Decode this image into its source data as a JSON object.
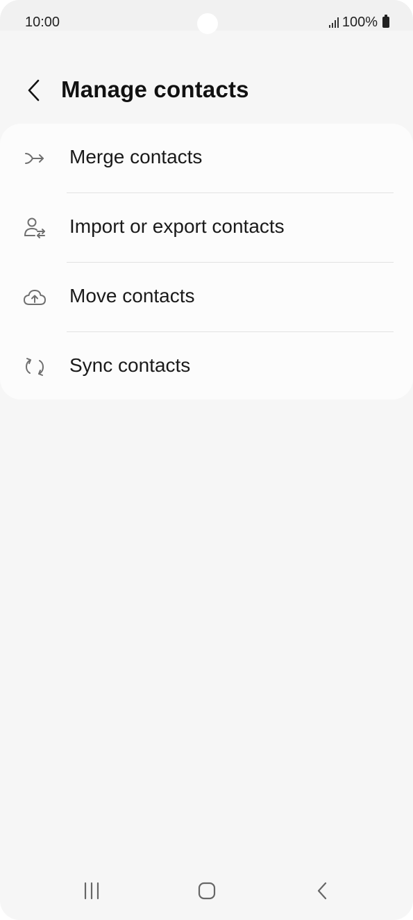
{
  "status_bar": {
    "time": "10:00",
    "battery": "100%"
  },
  "header": {
    "title": "Manage contacts",
    "back_icon": "chevron-left-icon"
  },
  "menu": {
    "items": [
      {
        "label": "Merge contacts",
        "icon": "merge-arrow-icon"
      },
      {
        "label": "Import or export contacts",
        "icon": "person-transfer-icon"
      },
      {
        "label": "Move contacts",
        "icon": "cloud-upload-icon"
      },
      {
        "label": "Sync contacts",
        "icon": "sync-icon"
      }
    ]
  },
  "nav_bar": {
    "recents_icon": "recents-icon",
    "home_icon": "home-icon",
    "back_icon": "back-icon"
  },
  "colors": {
    "background": "#f6f6f6",
    "card": "#fcfcfc",
    "icon": "#6f6f6f",
    "text": "#1a1a1a"
  }
}
